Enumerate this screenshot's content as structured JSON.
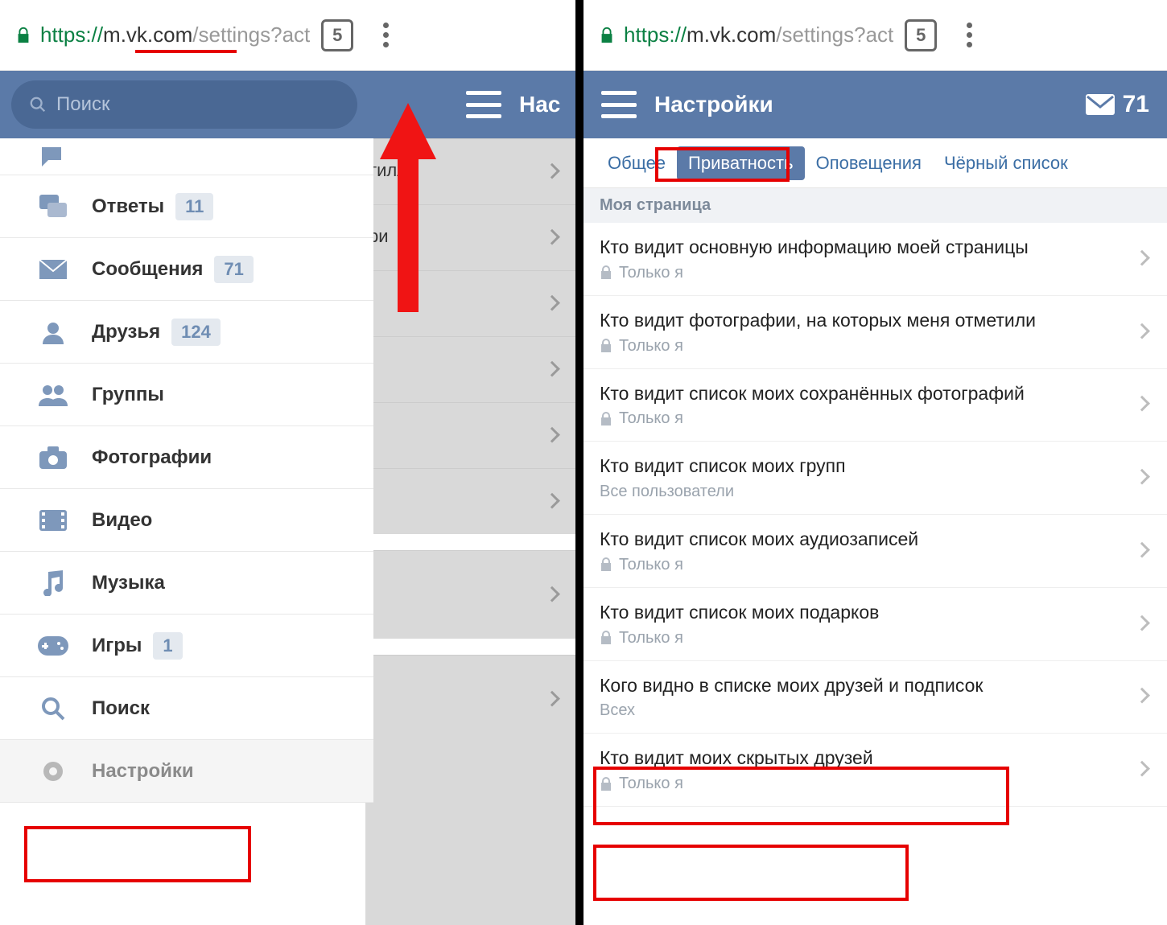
{
  "browser": {
    "url_proto": "https://",
    "url_host_prefix": "m.vk.com",
    "url_path": "/settings?act",
    "tab_count": "5"
  },
  "left": {
    "header_title_cut": "Нас",
    "search_placeholder": "Поиск",
    "menu": {
      "replies": {
        "label": "Ответы",
        "count": "11"
      },
      "messages": {
        "label": "Сообщения",
        "count": "71"
      },
      "friends": {
        "label": "Друзья",
        "count": "124"
      },
      "groups": {
        "label": "Группы"
      },
      "photos": {
        "label": "Фотографии"
      },
      "video": {
        "label": "Видео"
      },
      "music": {
        "label": "Музыка"
      },
      "games": {
        "label": "Игры",
        "count": "1"
      },
      "search": {
        "label": "Поиск"
      },
      "settings": {
        "label": "Настройки"
      }
    },
    "bg_rows": {
      "r1_text": "тилл",
      "r2_text": "ри"
    }
  },
  "right": {
    "header_title": "Настройки",
    "msg_count": "71",
    "tabs": {
      "general": "Общее",
      "privacy": "Приватность",
      "notifications": "Оповещения",
      "blacklist": "Чёрный список"
    },
    "section_title": "Моя страница",
    "items": [
      {
        "title": "Кто видит основную информацию моей страницы",
        "value": "Только я",
        "lock": true
      },
      {
        "title": "Кто видит фотографии, на которых меня отметили",
        "value": "Только я",
        "lock": true
      },
      {
        "title": "Кто видит список моих сохранённых фотографий",
        "value": "Только я",
        "lock": true
      },
      {
        "title": "Кто видит список моих групп",
        "value": "Все пользователи",
        "lock": false
      },
      {
        "title": "Кто видит список моих аудиозаписей",
        "value": "Только я",
        "lock": true
      },
      {
        "title": "Кто видит список моих подарков",
        "value": "Только я",
        "lock": true
      },
      {
        "title": "Кого видно в списке моих друзей и подписок",
        "value": "Всех",
        "lock": false
      },
      {
        "title": "Кто видит моих скрытых друзей",
        "value": "Только я",
        "lock": true
      }
    ]
  }
}
